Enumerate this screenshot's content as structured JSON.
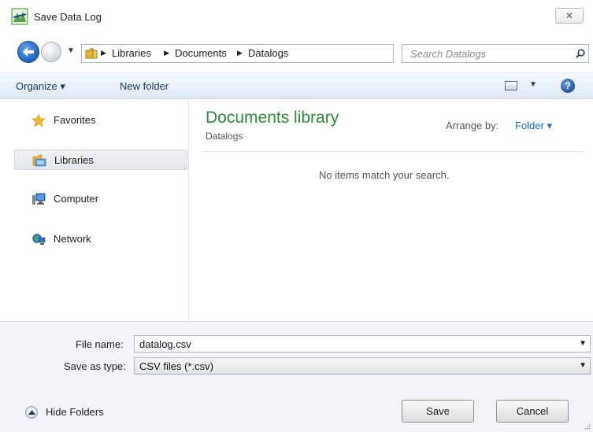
{
  "window": {
    "title": "Save Data Log",
    "close_symbol": "✕"
  },
  "address_bar": {
    "crumbs": [
      "Libraries",
      "Documents",
      "Datalogs"
    ],
    "refresh_symbol": "↻"
  },
  "search": {
    "placeholder": "Search Datalogs"
  },
  "toolbar": {
    "organize": "Organize ▾",
    "new_folder": "New folder",
    "help_symbol": "?"
  },
  "navigation": {
    "items": [
      {
        "label": "Favorites",
        "icon": "star-icon"
      },
      {
        "label": "Libraries",
        "icon": "libraries-icon",
        "selected": true
      },
      {
        "label": "Computer",
        "icon": "computer-icon"
      },
      {
        "label": "Network",
        "icon": "network-icon"
      }
    ]
  },
  "content": {
    "library_title": "Documents library",
    "library_subtitle": "Datalogs",
    "arrange_label": "Arrange by:",
    "arrange_value": "Folder ▾",
    "empty_message": "No items match your search."
  },
  "form": {
    "file_name_label": "File name:",
    "file_name_value": "datalog.csv",
    "save_type_label": "Save as type:",
    "save_type_value": "CSV files (*.csv)"
  },
  "footer": {
    "hide_folders": "Hide Folders",
    "save": "Save",
    "cancel": "Cancel"
  },
  "colors": {
    "library_title": "#2e8a3b",
    "link_blue": "#2b6cc0",
    "toolbar_text": "#1e3b64"
  }
}
